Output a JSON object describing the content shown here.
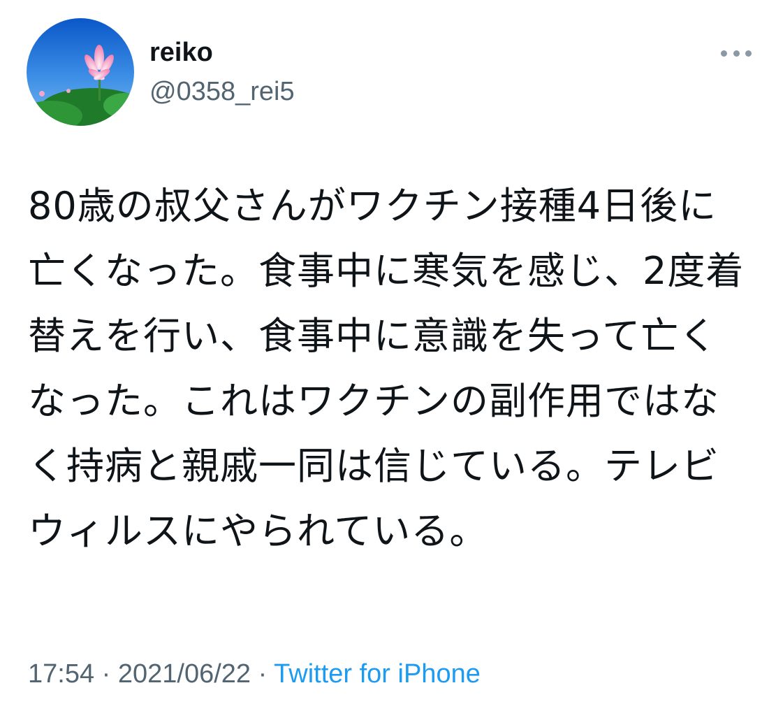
{
  "author": {
    "name": "reiko",
    "handle": "@0358_rei5"
  },
  "more_icon": "more-horizontal-icon",
  "avatar_icon": "lotus-avatar",
  "tweet": {
    "text": "80歳の叔父さんがワクチン接種4日後に亡くなった。食事中に寒気を感じ、2度着替えを行い、食事中に意識を失って亡くなった。これはワクチンの副作用ではなく持病と親戚一同は信じている。テレビウィルスにやられている。"
  },
  "meta": {
    "time": "17:54",
    "separator1": " · ",
    "date": "2021/06/22",
    "separator2": " · ",
    "source": "Twitter for iPhone"
  },
  "colors": {
    "text": "#0f1419",
    "secondary": "#536471",
    "link": "#1d9bf0"
  }
}
